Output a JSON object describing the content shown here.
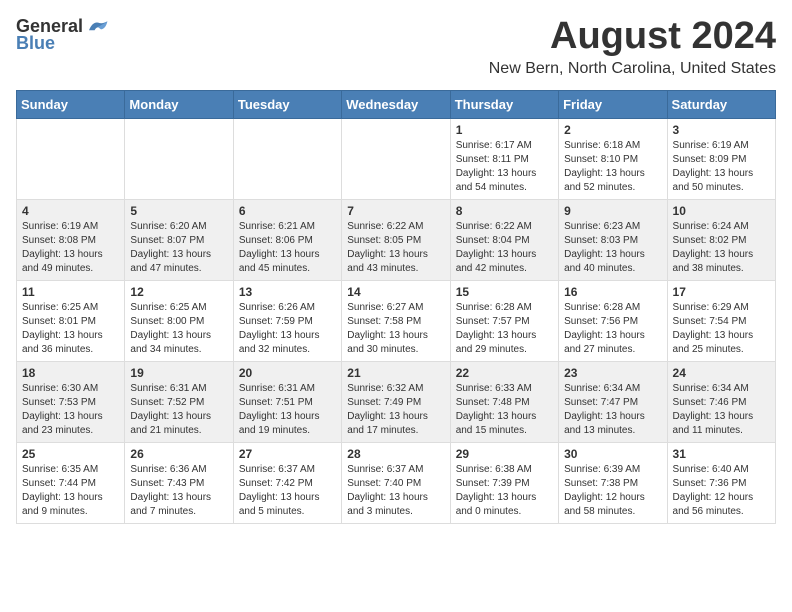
{
  "logo": {
    "general": "General",
    "blue": "Blue"
  },
  "header": {
    "month": "August 2024",
    "location": "New Bern, North Carolina, United States"
  },
  "weekdays": [
    "Sunday",
    "Monday",
    "Tuesday",
    "Wednesday",
    "Thursday",
    "Friday",
    "Saturday"
  ],
  "weeks": [
    [
      {
        "day": "",
        "info": ""
      },
      {
        "day": "",
        "info": ""
      },
      {
        "day": "",
        "info": ""
      },
      {
        "day": "",
        "info": ""
      },
      {
        "day": "1",
        "info": "Sunrise: 6:17 AM\nSunset: 8:11 PM\nDaylight: 13 hours\nand 54 minutes."
      },
      {
        "day": "2",
        "info": "Sunrise: 6:18 AM\nSunset: 8:10 PM\nDaylight: 13 hours\nand 52 minutes."
      },
      {
        "day": "3",
        "info": "Sunrise: 6:19 AM\nSunset: 8:09 PM\nDaylight: 13 hours\nand 50 minutes."
      }
    ],
    [
      {
        "day": "4",
        "info": "Sunrise: 6:19 AM\nSunset: 8:08 PM\nDaylight: 13 hours\nand 49 minutes."
      },
      {
        "day": "5",
        "info": "Sunrise: 6:20 AM\nSunset: 8:07 PM\nDaylight: 13 hours\nand 47 minutes."
      },
      {
        "day": "6",
        "info": "Sunrise: 6:21 AM\nSunset: 8:06 PM\nDaylight: 13 hours\nand 45 minutes."
      },
      {
        "day": "7",
        "info": "Sunrise: 6:22 AM\nSunset: 8:05 PM\nDaylight: 13 hours\nand 43 minutes."
      },
      {
        "day": "8",
        "info": "Sunrise: 6:22 AM\nSunset: 8:04 PM\nDaylight: 13 hours\nand 42 minutes."
      },
      {
        "day": "9",
        "info": "Sunrise: 6:23 AM\nSunset: 8:03 PM\nDaylight: 13 hours\nand 40 minutes."
      },
      {
        "day": "10",
        "info": "Sunrise: 6:24 AM\nSunset: 8:02 PM\nDaylight: 13 hours\nand 38 minutes."
      }
    ],
    [
      {
        "day": "11",
        "info": "Sunrise: 6:25 AM\nSunset: 8:01 PM\nDaylight: 13 hours\nand 36 minutes."
      },
      {
        "day": "12",
        "info": "Sunrise: 6:25 AM\nSunset: 8:00 PM\nDaylight: 13 hours\nand 34 minutes."
      },
      {
        "day": "13",
        "info": "Sunrise: 6:26 AM\nSunset: 7:59 PM\nDaylight: 13 hours\nand 32 minutes."
      },
      {
        "day": "14",
        "info": "Sunrise: 6:27 AM\nSunset: 7:58 PM\nDaylight: 13 hours\nand 30 minutes."
      },
      {
        "day": "15",
        "info": "Sunrise: 6:28 AM\nSunset: 7:57 PM\nDaylight: 13 hours\nand 29 minutes."
      },
      {
        "day": "16",
        "info": "Sunrise: 6:28 AM\nSunset: 7:56 PM\nDaylight: 13 hours\nand 27 minutes."
      },
      {
        "day": "17",
        "info": "Sunrise: 6:29 AM\nSunset: 7:54 PM\nDaylight: 13 hours\nand 25 minutes."
      }
    ],
    [
      {
        "day": "18",
        "info": "Sunrise: 6:30 AM\nSunset: 7:53 PM\nDaylight: 13 hours\nand 23 minutes."
      },
      {
        "day": "19",
        "info": "Sunrise: 6:31 AM\nSunset: 7:52 PM\nDaylight: 13 hours\nand 21 minutes."
      },
      {
        "day": "20",
        "info": "Sunrise: 6:31 AM\nSunset: 7:51 PM\nDaylight: 13 hours\nand 19 minutes."
      },
      {
        "day": "21",
        "info": "Sunrise: 6:32 AM\nSunset: 7:49 PM\nDaylight: 13 hours\nand 17 minutes."
      },
      {
        "day": "22",
        "info": "Sunrise: 6:33 AM\nSunset: 7:48 PM\nDaylight: 13 hours\nand 15 minutes."
      },
      {
        "day": "23",
        "info": "Sunrise: 6:34 AM\nSunset: 7:47 PM\nDaylight: 13 hours\nand 13 minutes."
      },
      {
        "day": "24",
        "info": "Sunrise: 6:34 AM\nSunset: 7:46 PM\nDaylight: 13 hours\nand 11 minutes."
      }
    ],
    [
      {
        "day": "25",
        "info": "Sunrise: 6:35 AM\nSunset: 7:44 PM\nDaylight: 13 hours\nand 9 minutes."
      },
      {
        "day": "26",
        "info": "Sunrise: 6:36 AM\nSunset: 7:43 PM\nDaylight: 13 hours\nand 7 minutes."
      },
      {
        "day": "27",
        "info": "Sunrise: 6:37 AM\nSunset: 7:42 PM\nDaylight: 13 hours\nand 5 minutes."
      },
      {
        "day": "28",
        "info": "Sunrise: 6:37 AM\nSunset: 7:40 PM\nDaylight: 13 hours\nand 3 minutes."
      },
      {
        "day": "29",
        "info": "Sunrise: 6:38 AM\nSunset: 7:39 PM\nDaylight: 13 hours\nand 0 minutes."
      },
      {
        "day": "30",
        "info": "Sunrise: 6:39 AM\nSunset: 7:38 PM\nDaylight: 12 hours\nand 58 minutes."
      },
      {
        "day": "31",
        "info": "Sunrise: 6:40 AM\nSunset: 7:36 PM\nDaylight: 12 hours\nand 56 minutes."
      }
    ]
  ]
}
